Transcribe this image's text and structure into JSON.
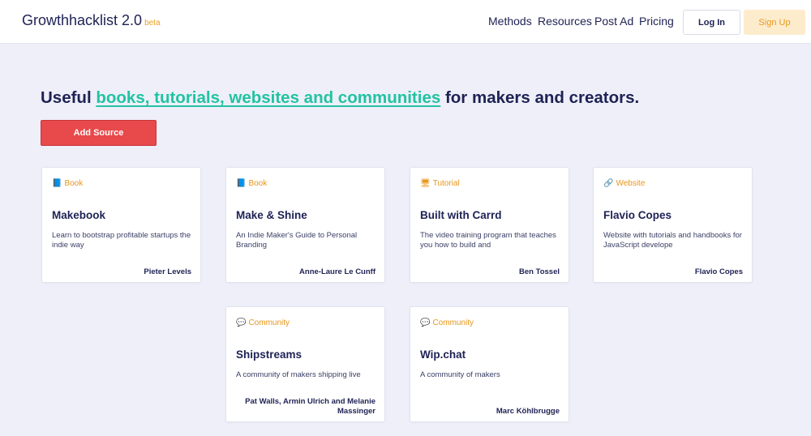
{
  "header": {
    "logo": "Growthhacklist 2.0",
    "beta": "beta",
    "nav": [
      "Methods",
      "Resources",
      "Post Ad",
      "Pricing"
    ],
    "login": "Log In",
    "signup": "Sign Up"
  },
  "hero": {
    "prefix": "Useful ",
    "link": "books, tutorials, websites and communities",
    "suffix": " for makers and creators.",
    "add_button": "Add Source"
  },
  "cards": [
    {
      "icon": "book-icon",
      "category": "Book",
      "title": "Makebook",
      "description": "Learn to bootstrap profitable startups the indie way",
      "author": "Pieter Levels"
    },
    {
      "icon": "book-icon",
      "category": "Book",
      "title": "Make & Shine",
      "description": "An Indie Maker's Guide to Personal Branding",
      "author": "Anne-Laure Le Cunff"
    },
    {
      "icon": "computer-icon",
      "category": "Tutorial",
      "title": "Built with Carrd",
      "description": "The video training program that teaches you how to build and",
      "author": "Ben Tossel"
    },
    {
      "icon": "link-icon",
      "category": "Website",
      "title": "Flavio Copes",
      "description": "Website with tutorials and handbooks for JavaScript develope",
      "author": "Flavio Copes"
    },
    {
      "icon": "speech-bubble-icon",
      "category": "Community",
      "title": "Shipstreams",
      "description": "A community of makers shipping live",
      "author": "Pat Walls, Armin Ulrich and Melanie Massinger"
    },
    {
      "icon": "speech-bubble-icon",
      "category": "Community",
      "title": "Wip.chat",
      "description": "A community of makers",
      "author": "Marc Köhlbrugge"
    }
  ]
}
